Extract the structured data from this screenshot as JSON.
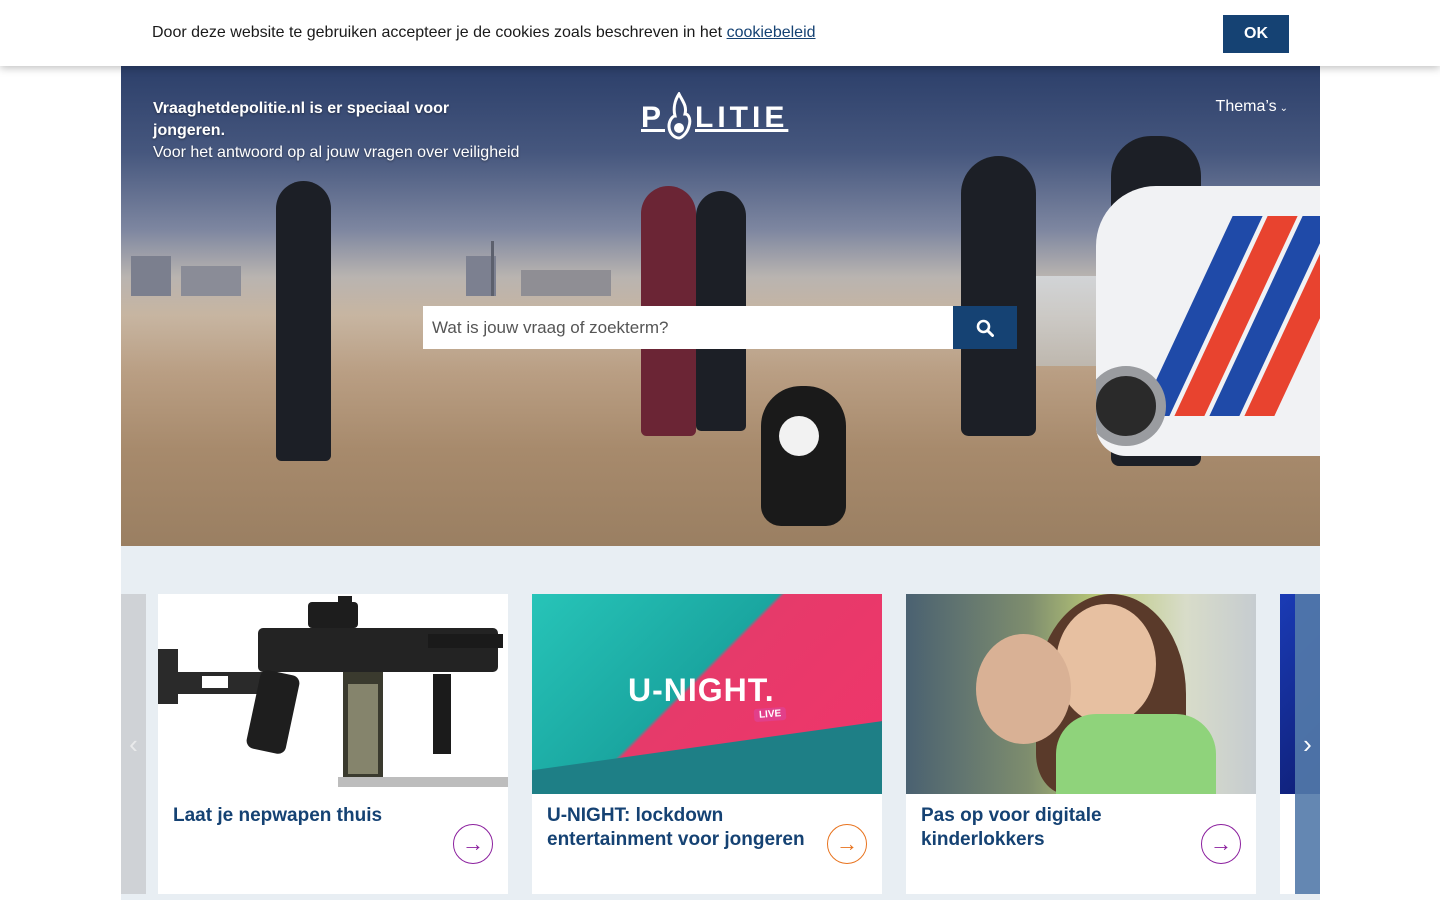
{
  "cookie": {
    "text": "Door deze website te gebruiken accepteer je de cookies zoals beschreven in het ",
    "link_label": "cookiebeleid",
    "ok_label": "OK"
  },
  "header": {
    "intro_strong": "Vraaghetdepolitie.nl is er speciaal voor jongeren.",
    "intro_rest": "Voor het antwoord op al jouw vragen over veiligheid",
    "logo_text": "LITIE",
    "logo_prefix": "P",
    "themes_label": "Thema’s"
  },
  "search": {
    "placeholder": "Wat is jouw vraag of zoekterm?"
  },
  "carousel": {
    "prev_label": "‹",
    "next_label": "›",
    "cards": [
      {
        "title": "Laat je nepwapen thuis",
        "arrow": "→",
        "accent": "#8b1f9e"
      },
      {
        "title": "U-NIGHT: lockdown entertainment voor jongeren",
        "arrow": "→",
        "accent": "#e8731e",
        "image_logo": "U-NIGHT.",
        "image_badge": "LIVE"
      },
      {
        "title": "Pas op voor digitale kinderlokkers",
        "arrow": "→",
        "accent": "#8b1f9e"
      }
    ]
  },
  "colors": {
    "brand": "#154273",
    "arrow_purple": "#8b1f9e",
    "arrow_orange": "#e8731e"
  },
  "icons": {
    "search": "search-icon",
    "next": "chevron-right-icon",
    "prev": "chevron-left-icon",
    "arrow": "arrow-right-icon"
  }
}
